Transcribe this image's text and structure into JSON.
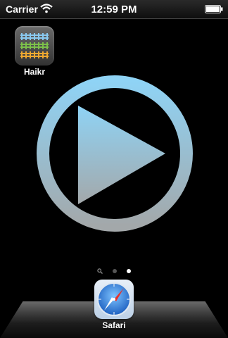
{
  "status_bar": {
    "carrier": "Carrier",
    "time": "12:59 PM",
    "wifi_icon": "wifi-icon",
    "battery_icon": "battery-icon",
    "battery_level": 1.0
  },
  "home": {
    "apps": [
      {
        "label": "Haikr",
        "icon": "haikr-app-icon"
      }
    ],
    "center_graphic": "play-icon"
  },
  "page_indicator": {
    "pages": 3,
    "active_index": 2,
    "first_is_search": true
  },
  "dock": {
    "apps": [
      {
        "label": "Safari",
        "icon": "safari-compass-icon"
      }
    ]
  }
}
